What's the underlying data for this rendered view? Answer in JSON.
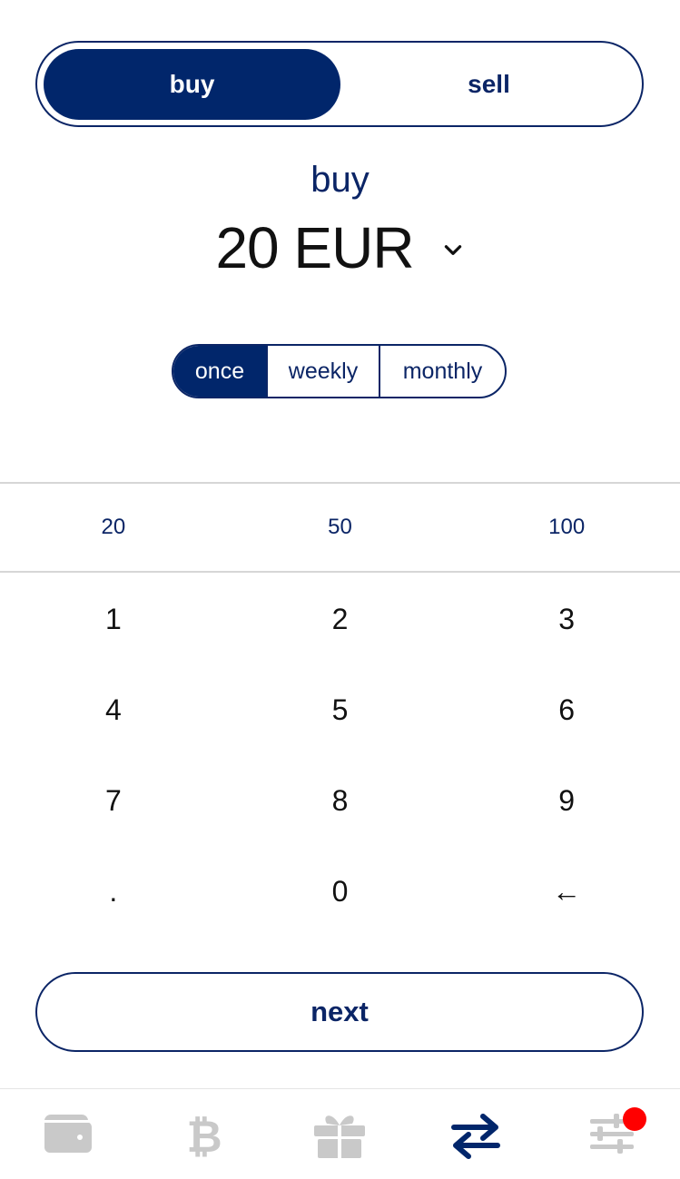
{
  "trade_toggle": {
    "buy_label": "buy",
    "sell_label": "sell",
    "selected": "buy"
  },
  "amount": {
    "mode_label": "buy",
    "value": "20 EUR",
    "dropdown_icon": "chevron-down-icon"
  },
  "frequency": {
    "options": [
      {
        "label": "once",
        "active": true
      },
      {
        "label": "weekly",
        "active": false
      },
      {
        "label": "monthly",
        "active": false
      }
    ]
  },
  "presets": [
    "20",
    "50",
    "100"
  ],
  "keypad": {
    "rows": [
      [
        "1",
        "2",
        "3"
      ],
      [
        "4",
        "5",
        "6"
      ],
      [
        "7",
        "8",
        "9"
      ],
      [
        ".",
        "0",
        "←"
      ]
    ]
  },
  "next_label": "next",
  "tabbar": {
    "items": [
      {
        "icon": "wallet-icon",
        "active": false
      },
      {
        "icon": "bitcoin-icon",
        "active": false
      },
      {
        "icon": "gift-icon",
        "active": false
      },
      {
        "icon": "exchange-arrows-icon",
        "active": true
      },
      {
        "icon": "settings-sliders-icon",
        "active": false,
        "notification": true
      }
    ]
  },
  "colors": {
    "primary": "#01266b",
    "inactive_icon": "#c9c9c9",
    "badge": "#ff0000",
    "divider": "#d6d6d6"
  }
}
